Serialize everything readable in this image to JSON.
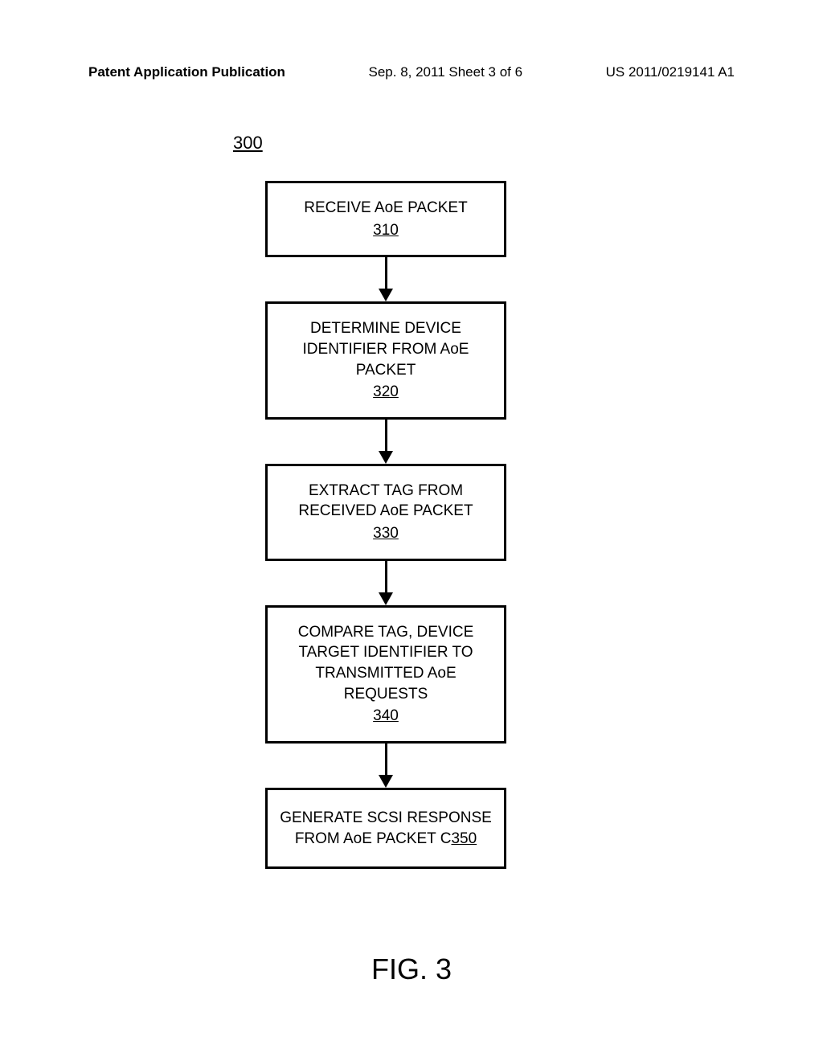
{
  "header": {
    "left": "Patent Application Publication",
    "center": "Sep. 8, 2011  Sheet 3 of 6",
    "right": "US 2011/0219141 A1"
  },
  "figure_number": "300",
  "boxes": {
    "b1": {
      "text": "RECEIVE AoE PACKET",
      "ref": "310"
    },
    "b2": {
      "text": "DETERMINE DEVICE IDENTIFIER FROM AoE PACKET",
      "ref": "320"
    },
    "b3": {
      "text": "EXTRACT TAG FROM RECEIVED AoE PACKET",
      "ref": "330"
    },
    "b4": {
      "text": "COMPARE TAG, DEVICE TARGET IDENTIFIER TO TRANSMITTED AoE REQUESTS",
      "ref": "340"
    },
    "b5": {
      "text": "GENERATE SCSI RESPONSE FROM AoE PACKET C",
      "ref": "350"
    }
  },
  "figure_label": "FIG. 3"
}
